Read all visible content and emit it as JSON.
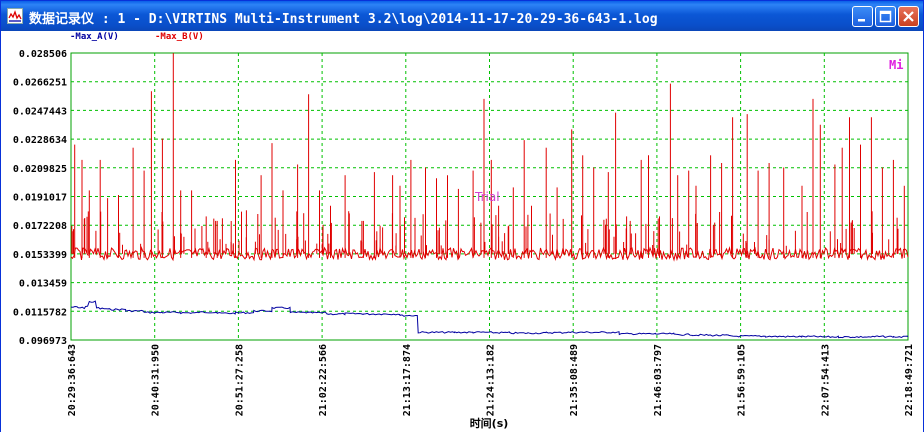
{
  "window": {
    "title": "数据记录仪 : 1 - D:\\VIRTINS Multi-Instrument 3.2\\log\\2014-11-17-20-29-36-643-1.log",
    "icon": "logger-app-icon",
    "buttons": [
      "minimize-icon",
      "maximize-icon",
      "close-icon"
    ]
  },
  "chart_data": {
    "type": "line",
    "legend": [
      {
        "name": "Max_A(V)",
        "color": "#0000a0"
      },
      {
        "name": "Max_B(V)",
        "color": "#e00000"
      }
    ],
    "legend_placement": "top-left",
    "y_tick_labels": [
      "0.028506",
      "0.0266251",
      "0.0247443",
      "0.0228634",
      "0.0209825",
      "0.0191017",
      "0.0172208",
      "0.0153399",
      "0.013459",
      "0.0115782",
      "0.096973"
    ],
    "ylim": [
      0.0096973,
      0.028506
    ],
    "x_tick_labels": [
      "20:29:36:643",
      "20:40:31:950",
      "20:51:27:258",
      "21:02:22:566",
      "21:13:17:874",
      "21:24:13:182",
      "21:35:08:489",
      "21:46:03:797",
      "21:56:59:105",
      "22:07:54:413",
      "22:18:49:721"
    ],
    "xlabel": "时间(s)",
    "grid": true,
    "annotations": [
      "Trial",
      "Mi"
    ],
    "series": [
      {
        "name": "Max_A(V)",
        "color": "#0000a0",
        "x_minutes": [
          0,
          2,
          4,
          5,
          7,
          8,
          10,
          15,
          20,
          25,
          30,
          35,
          40,
          45,
          50,
          55,
          60,
          65,
          70,
          75,
          80,
          85,
          90,
          92,
          95,
          100,
          105,
          110,
          115,
          120,
          125,
          130,
          135,
          140,
          145,
          150,
          155,
          160,
          165,
          170,
          175,
          180,
          185,
          190,
          195,
          200,
          205,
          210,
          215,
          220,
          225,
          229
        ],
        "values": [
          0.01185,
          0.0118,
          0.0119,
          0.0122,
          0.0118,
          0.01175,
          0.0117,
          0.0116,
          0.0115,
          0.0115,
          0.01148,
          0.01152,
          0.01145,
          0.01148,
          0.0116,
          0.0118,
          0.0115,
          0.01148,
          0.0114,
          0.01142,
          0.0114,
          0.0114,
          0.0113,
          0.0113,
          0.0102,
          0.0102,
          0.0102,
          0.0102,
          0.01018,
          0.01015,
          0.01015,
          0.01018,
          0.0102,
          0.0102,
          0.0102,
          0.0101,
          0.0101,
          0.0101,
          0.01005,
          0.01002,
          0.01,
          0.00995,
          0.00995,
          0.00993,
          0.00992,
          0.00992,
          0.0099,
          0.0099,
          0.0099,
          0.00992,
          0.0099,
          0.0099
        ]
      },
      {
        "name": "Max_B(V)",
        "color": "#e00000",
        "baseline": 0.01534,
        "spike_x_minutes": [
          1,
          3,
          5,
          8,
          10,
          13,
          17,
          20,
          22,
          25,
          28,
          30,
          33,
          37,
          40,
          45,
          48,
          52,
          55,
          58,
          62,
          65,
          68,
          71,
          75,
          80,
          83,
          88,
          90,
          93,
          97,
          100,
          103,
          106,
          110,
          113,
          115,
          117,
          121,
          124,
          126,
          130,
          133,
          137,
          140,
          143,
          147,
          149,
          152,
          156,
          158,
          161,
          164,
          166,
          169,
          171,
          175,
          178,
          181,
          185,
          188,
          191,
          195,
          200,
          203,
          205,
          209,
          211,
          213,
          216,
          219,
          222,
          225,
          228
        ],
        "spike_values": [
          0.0225,
          0.0215,
          0.0195,
          0.0215,
          0.019,
          0.0192,
          0.0223,
          0.0208,
          0.026,
          0.0229,
          0.0285,
          0.0195,
          0.0195,
          0.0178,
          0.0175,
          0.0215,
          0.0182,
          0.0205,
          0.0226,
          0.0195,
          0.0212,
          0.0258,
          0.0195,
          0.0185,
          0.0205,
          0.0175,
          0.0207,
          0.0205,
          0.0198,
          0.0215,
          0.021,
          0.0203,
          0.0205,
          0.0196,
          0.0208,
          0.0255,
          0.0215,
          0.0185,
          0.0197,
          0.0228,
          0.0185,
          0.0223,
          0.0197,
          0.0235,
          0.0218,
          0.021,
          0.0207,
          0.0246,
          0.0178,
          0.0215,
          0.0218,
          0.0178,
          0.0265,
          0.0205,
          0.0208,
          0.0198,
          0.0218,
          0.0213,
          0.0243,
          0.0245,
          0.0208,
          0.0213,
          0.021,
          0.0198,
          0.0255,
          0.0238,
          0.0212,
          0.0223,
          0.0243,
          0.0225,
          0.0243,
          0.021,
          0.0215,
          0.0198
        ]
      }
    ]
  }
}
